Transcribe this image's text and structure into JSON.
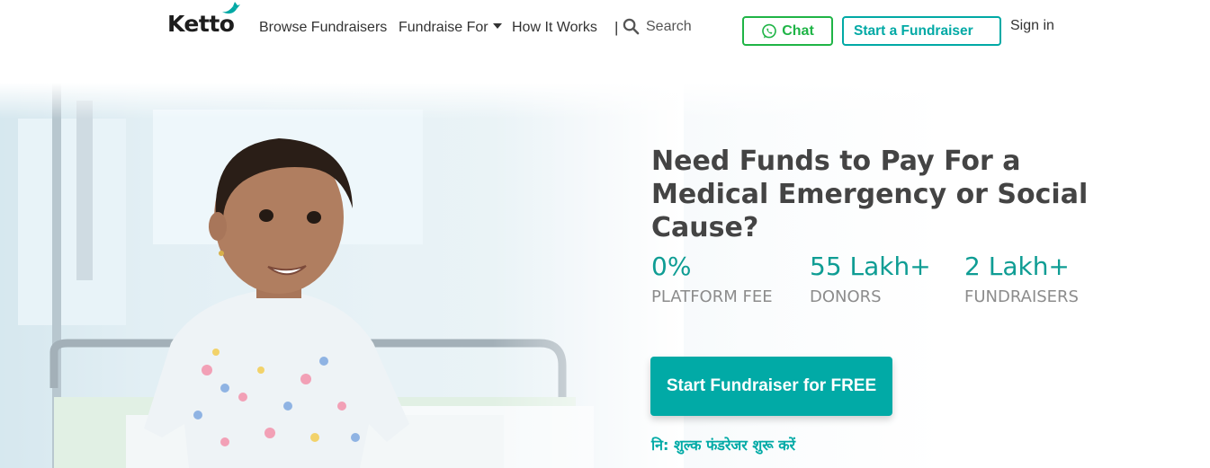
{
  "brand": {
    "logo_text": "Ketto",
    "accent_color": "#01a9a5",
    "chat_color": "#1fb446"
  },
  "nav": {
    "browse": "Browse Fundraisers",
    "fundraise_for": "Fundraise For",
    "how_it_works": "How It Works",
    "separator": "|",
    "search": "Search",
    "chat": "Chat",
    "start_fundraiser": "Start a Fundraiser",
    "sign_in": "Sign in"
  },
  "icons": {
    "logo_mark": "bird-icon",
    "search": "search-icon",
    "chat": "whatsapp-icon",
    "fundraise_dropdown": "caret-down-icon"
  },
  "hero": {
    "headline": "Need Funds to Pay For a Medical Emergency or Social Cause?",
    "image": "smiling-child-on-hospital-bed-photo",
    "stats": [
      {
        "value": "0%",
        "label": "PLATFORM FEE"
      },
      {
        "value": "55 Lakh+",
        "label": "DONORS"
      },
      {
        "value": "2 Lakh+",
        "label": "FUNDRAISERS"
      }
    ],
    "cta": "Start Fundraiser for FREE",
    "cta_hindi": "नि: शुल्क फंडरेजर शुरू करें"
  }
}
